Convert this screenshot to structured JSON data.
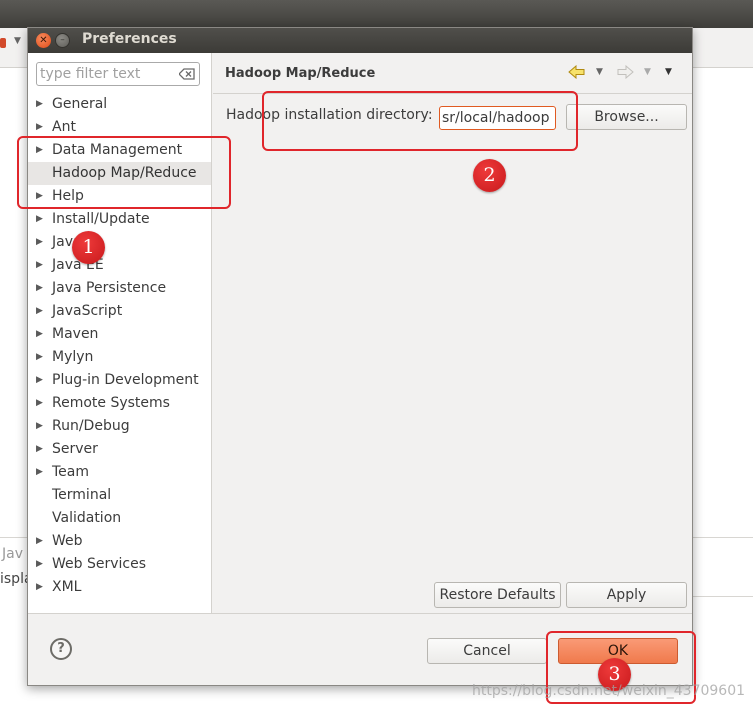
{
  "dialog": {
    "title": "Preferences"
  },
  "filter": {
    "placeholder": "type filter text",
    "value": ""
  },
  "nav": {
    "items": [
      {
        "label": "General",
        "arrow": "▶"
      },
      {
        "label": "Ant",
        "arrow": "▶"
      },
      {
        "label": "Data Management",
        "arrow": "▶"
      },
      {
        "label": "Hadoop Map/Reduce",
        "arrow": "",
        "selected": true
      },
      {
        "label": "Help",
        "arrow": "▶"
      },
      {
        "label": "Install/Update",
        "arrow": "▶"
      },
      {
        "label": "Java",
        "arrow": "▶"
      },
      {
        "label": "Java EE",
        "arrow": "▶"
      },
      {
        "label": "Java Persistence",
        "arrow": "▶"
      },
      {
        "label": "JavaScript",
        "arrow": "▶"
      },
      {
        "label": "Maven",
        "arrow": "▶"
      },
      {
        "label": "Mylyn",
        "arrow": "▶"
      },
      {
        "label": "Plug-in Development",
        "arrow": "▶"
      },
      {
        "label": "Remote Systems",
        "arrow": "▶"
      },
      {
        "label": "Run/Debug",
        "arrow": "▶"
      },
      {
        "label": "Server",
        "arrow": "▶"
      },
      {
        "label": "Team",
        "arrow": "▶"
      },
      {
        "label": "Terminal",
        "arrow": ""
      },
      {
        "label": "Validation",
        "arrow": ""
      },
      {
        "label": "Web",
        "arrow": "▶"
      },
      {
        "label": "Web Services",
        "arrow": "▶"
      },
      {
        "label": "XML",
        "arrow": "▶"
      }
    ]
  },
  "page": {
    "title": "Hadoop Map/Reduce",
    "install_dir_label": "Hadoop installation directory:",
    "install_dir_value": "sr/local/hadoop",
    "browse_label": "Browse...",
    "restore_label": "Restore Defaults",
    "apply_label": "Apply"
  },
  "footer": {
    "help_symbol": "?",
    "cancel_label": "Cancel",
    "ok_label": "OK"
  },
  "background": {
    "text_1": "Jav",
    "text_2": "ispla"
  },
  "annotations": {
    "num_1": "1",
    "num_2": "2",
    "num_3": "3"
  },
  "watermark": "https://blog.csdn.net/weixin_43709601",
  "icons": {
    "close": "close-icon",
    "minimize": "minimize-icon",
    "clear": "clear-filter-icon",
    "back": "back-arrow-icon",
    "forward": "forward-arrow-icon",
    "menu": "view-menu-icon",
    "help": "help-icon"
  },
  "colors": {
    "accent": "#f07a4c",
    "annotation_red": "#e0262b",
    "titlebar": "#3c3b37"
  }
}
